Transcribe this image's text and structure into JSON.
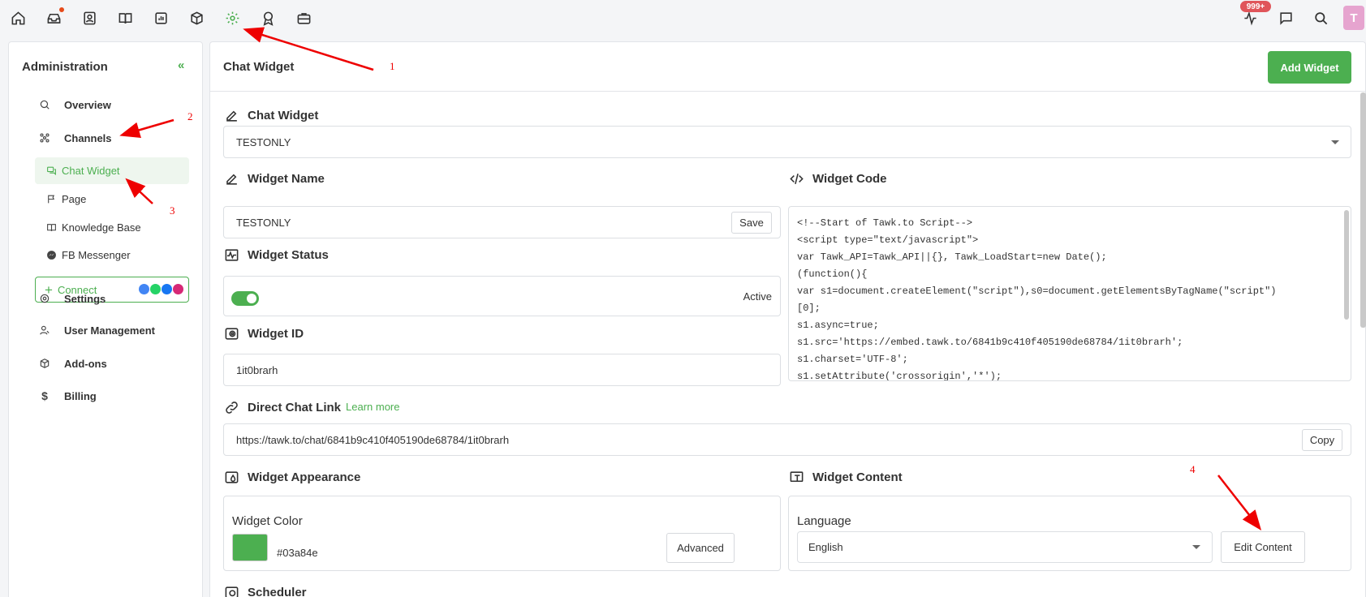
{
  "topbar": {
    "notification_count": "999+",
    "avatar_initial": "T",
    "icons": [
      "home-icon",
      "inbox-icon",
      "contacts-icon",
      "knowledge-book-icon",
      "reports-icon",
      "box-icon",
      "settings-gear-icon",
      "award-icon",
      "briefcase-icon",
      "activity-icon",
      "chat-bubble-icon",
      "search-icon"
    ]
  },
  "sidebar": {
    "title": "Administration",
    "items": {
      "overview": "Overview",
      "channels": "Channels",
      "settings": "Settings",
      "user_management": "User Management",
      "addons": "Add-ons",
      "billing": "Billing"
    },
    "channels_sub": {
      "chat_widget": "Chat Widget",
      "page": "Page",
      "knowledge_base": "Knowledge Base",
      "fb_messenger": "FB Messenger"
    },
    "connect_label": "Connect"
  },
  "main": {
    "title": "Chat Widget",
    "add_widget_label": "Add Widget",
    "chat_widget_section": "Chat Widget",
    "selected_widget": "TESTONLY",
    "widget_name_label": "Widget Name",
    "widget_name_value": "TESTONLY",
    "save_label": "Save",
    "widget_status_label": "Widget Status",
    "status_value": "Active",
    "widget_id_label": "Widget ID",
    "widget_id_value": "1it0brarh",
    "widget_code_label": "Widget Code",
    "code_lines": [
      "<!--Start of Tawk.to Script-->",
      "<script type=\"text/javascript\">",
      "var Tawk_API=Tawk_API||{}, Tawk_LoadStart=new Date();",
      "(function(){",
      "var s1=document.createElement(\"script\"),s0=document.getElementsByTagName(\"script\")",
      "[0];",
      "s1.async=true;",
      "s1.src='https://embed.tawk.to/6841b9c410f405190de68784/1it0brarh';",
      "s1.charset='UTF-8';",
      "s1.setAttribute('crossorigin','*');"
    ],
    "direct_link_label": "Direct Chat Link",
    "learn_more": "Learn more",
    "direct_link_value": "https://tawk.to/chat/6841b9c410f405190de68784/1it0brarh",
    "copy_label": "Copy",
    "appearance_label": "Widget Appearance",
    "widget_color_label": "Widget Color",
    "widget_color_value": "#03a84e",
    "advanced_label": "Advanced",
    "content_label": "Widget Content",
    "language_label": "Language",
    "language_value": "English",
    "edit_content_label": "Edit Content",
    "scheduler_label": "Scheduler"
  },
  "annotations": [
    "1",
    "2",
    "3",
    "4"
  ],
  "colors": {
    "accent": "#4caf50",
    "annotation": "#ee0000",
    "badge": "#e0555a"
  }
}
